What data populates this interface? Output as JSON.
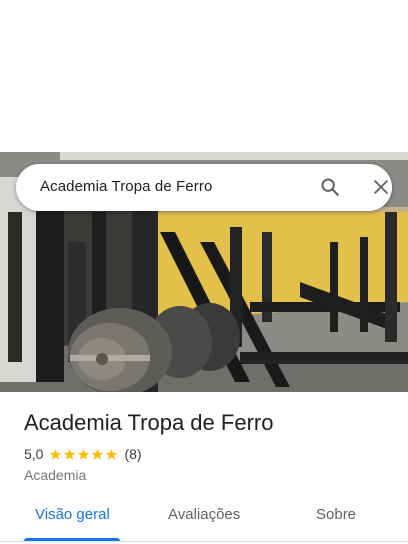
{
  "search": {
    "query": "Academia Tropa de Ferro"
  },
  "place": {
    "name": "Academia Tropa de Ferro",
    "rating": "5,0",
    "stars": 5,
    "review_count": "(8)",
    "category": "Academia"
  },
  "tabs": [
    {
      "label": "Visão geral",
      "active": true
    },
    {
      "label": "Avaliações",
      "active": false
    },
    {
      "label": "Sobre",
      "active": false
    }
  ],
  "colors": {
    "accent": "#1a73e8",
    "star": "#fbbc04"
  }
}
